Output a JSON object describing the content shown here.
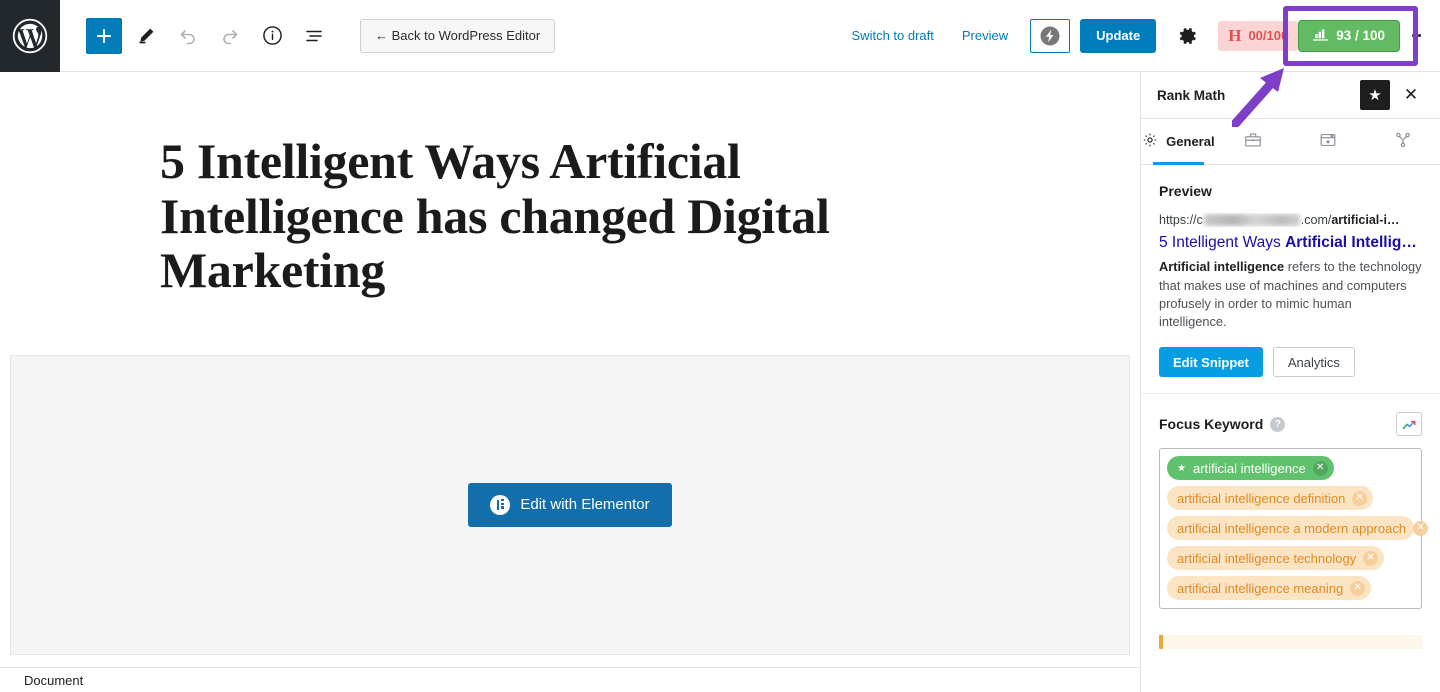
{
  "toolbar": {
    "logo_icon": "wordpress-logo-icon",
    "add_block_label": "+",
    "back_button_label": "← Back to WordPress Editor",
    "switch_to_draft_label": "Switch to draft",
    "preview_label": "Preview",
    "update_label": "Update",
    "amp_icon": "lightning-bolt-icon",
    "settings_icon": "gear-icon",
    "hemingway": {
      "mark": "H",
      "score": "00/100",
      "bg": "#fbd5d5",
      "fg": "#e05252"
    },
    "seo_score": {
      "value": "93 / 100",
      "icon": "bar-chart-icon",
      "bg": "#62bb62"
    },
    "annotation_color": "#7e3ec8"
  },
  "editor": {
    "post_title": "5 Intelligent Ways Artificial Intelligence has changed Digital Marketing",
    "elementor_button_label": "Edit with Elementor",
    "elementor_button_color": "#136fab"
  },
  "bottombar": {
    "breadcrumb": "Document"
  },
  "sidebar": {
    "title": "Rank Math",
    "star_icon": "star-icon",
    "close_icon": "close-icon",
    "tabs": [
      {
        "label": "General",
        "icon": "gear-icon",
        "active": true
      },
      {
        "label": "",
        "icon": "toolbox-icon",
        "active": false
      },
      {
        "label": "",
        "icon": "schema-window-star-icon",
        "active": false
      },
      {
        "label": "",
        "icon": "social-share-icon",
        "active": false
      }
    ],
    "preview": {
      "heading": "Preview",
      "url_prefix": "https://c",
      "url_redacted": true,
      "url_suffix": ".com/",
      "url_slug": "artificial-i…",
      "title_plain": "5 Intelligent Ways ",
      "title_bold": "Artificial Intellig…",
      "desc_bold": "Artificial intelligence",
      "desc_rest": " refers to the technology that makes use of machines and computers profusely in order to mimic human intelligence.",
      "edit_snippet_label": "Edit Snippet",
      "analytics_label": "Analytics"
    },
    "focus_keyword": {
      "label": "Focus Keyword",
      "help_icon": "help-icon",
      "trend_icon": "trending-up-icon",
      "keywords": [
        {
          "text": "artificial intelligence",
          "primary": true
        },
        {
          "text": "artificial intelligence definition",
          "primary": false
        },
        {
          "text": "artificial intelligence a modern approach",
          "primary": false
        },
        {
          "text": "artificial intelligence technology",
          "primary": false
        },
        {
          "text": "artificial intelligence meaning",
          "primary": false
        }
      ]
    }
  }
}
